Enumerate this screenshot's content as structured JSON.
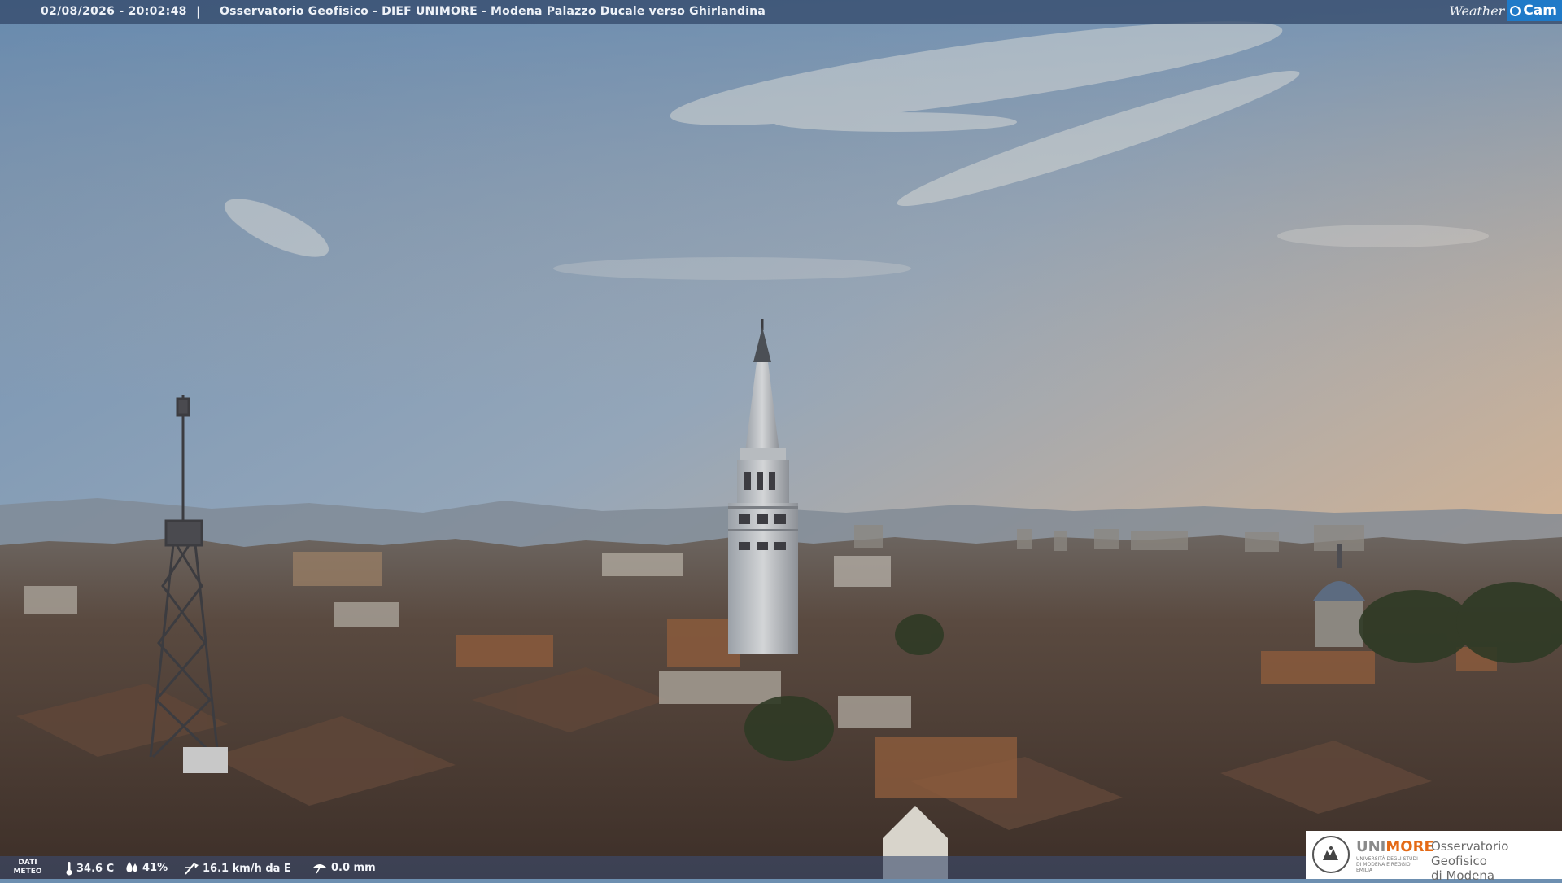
{
  "overlay": {
    "timestamp": "02/08/2026 - 20:02:48",
    "separator": "|",
    "title": "Osservatorio Geofisico - DIEF UNIMORE - Modena Palazzo Ducale verso Ghirlandina",
    "brand_weather": "Weather",
    "brand_cam": "Cam"
  },
  "weather": {
    "label_line1": "DATI",
    "label_line2": "METEO",
    "temperature": "34.6 C",
    "humidity": "41%",
    "wind": "16.1 km/h da E",
    "rain": "0.0 mm",
    "icons": [
      "thermometer-icon",
      "humidity-drop-icon",
      "wind-icon",
      "rain-gauge-icon"
    ]
  },
  "logo": {
    "university_gray": "UNI",
    "university_orange": "MORE",
    "university_sub": "UNIVERSITÀ DEGLI STUDI DI MODENA E REGGIO EMILIA",
    "observatory_line1": "Osservatorio Geofisico",
    "observatory_line2": "di Modena"
  },
  "colors": {
    "sky_top": "#6b8db0",
    "sky_horizon": "#e8b888",
    "roofs": "#4a3a30",
    "overlay_bar": "#344a6c",
    "brand_blue": "#1f7ac8",
    "unimore_orange": "#e46a16"
  }
}
